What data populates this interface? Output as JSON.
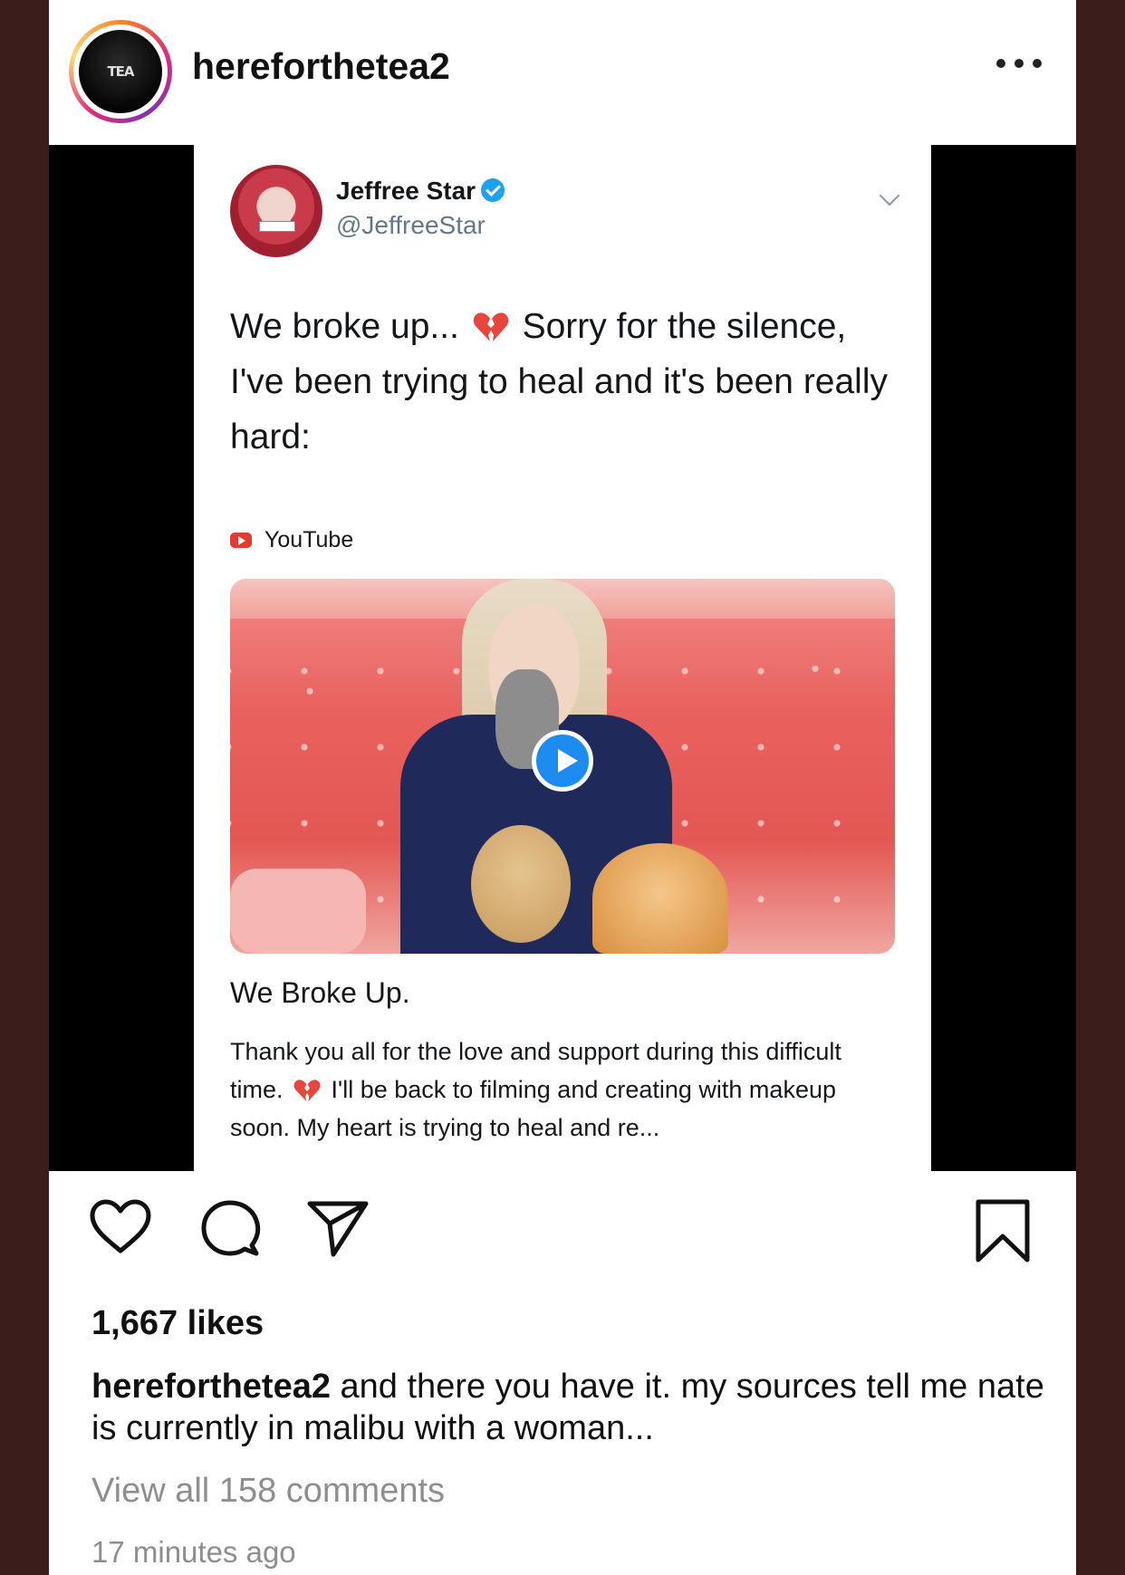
{
  "post": {
    "username": "hereforthetea2",
    "avatar_text": "TEA",
    "more_icon": "more-horizontal-icon"
  },
  "tweet": {
    "display_name": "Jeffree Star",
    "handle": "@JeffreeStar",
    "text_part1": "We broke up...",
    "text_part2": "Sorry for the silence, I've been trying to heal and it's been really hard:",
    "link_source": "YouTube",
    "video_title": "We Broke Up.",
    "video_desc_part1": "Thank you all for the love and support during this difficult time.",
    "video_desc_part2": "I'll be back to filming and creating with makeup soon. My heart is trying to heal and re...",
    "accent": "#1da1f2"
  },
  "actions": {
    "likes": "1,667 likes",
    "caption_user": "hereforthetea2",
    "caption_text": " and there you have it. my sources tell me nate is currently in malibu with a woman...",
    "view_comments": "View all 158 comments",
    "timestamp": "17 minutes ago"
  }
}
